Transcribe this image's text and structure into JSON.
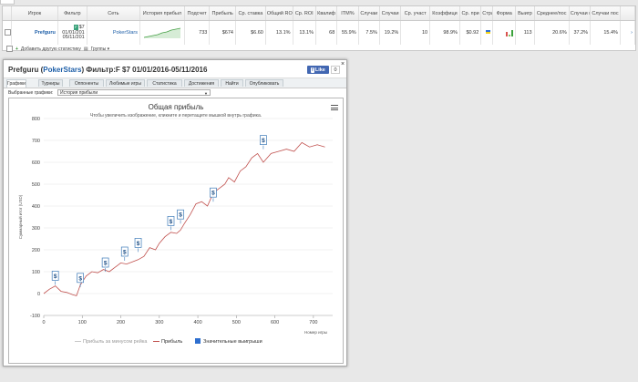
{
  "table": {
    "headers": [
      "",
      "Игрок",
      "Фильтр",
      "Сеть",
      "История прибыл",
      "Подсчет",
      "Прибыль",
      "Ср. ставка",
      "Общий ROI",
      "Ср. ROI",
      "Квалиф",
      "ITM%",
      "Случаи",
      "Случаи",
      "Ср. участ",
      "Коэффици",
      "Ср. при",
      "Стра",
      "Форма",
      "Выигр",
      "Среднее/пос",
      "Случаи пос",
      "Случаи пос",
      ""
    ],
    "row": {
      "player": "Prefguru",
      "filter_lines": [
        "$7",
        "01/01/201",
        "05/11/201"
      ],
      "site": "PokerStars",
      "count": "733",
      "profit": "$674",
      "avg_stake": "$6.60",
      "total_roi": "13.1%",
      "avg_roi": "13.1%",
      "qualif": "68",
      "itm": "55.9%",
      "cases1": "7.5%",
      "cases2": "19.2%",
      "avg_part": "10",
      "coeff": "98.9%",
      "avg_pr": "$0.92",
      "wins": "113",
      "avg_pos": "20.6%",
      "cases_pos1": "37.2%",
      "cases_pos2": "15.4%",
      "arrow": "›"
    },
    "footer_add": "Добавить другую статистику",
    "footer_groups": "Группы ▾"
  },
  "modal": {
    "title_name": "Prefguru",
    "title_site": "PokerStars",
    "title_rest": " Фильтр:F $7 01/01/2016-05/11/2016",
    "fb_like": "Like",
    "fb_count": "0",
    "close": "×",
    "tabs": [
      "Графики",
      "Турниры",
      "Оппоненты",
      "Любимые игры",
      "Статистика",
      "Достижения",
      "Найти",
      "Опубликовать"
    ],
    "selected_label": "Выбранные графики:",
    "selected_value": "История прибыли"
  },
  "colors": {
    "profit_line": "#c0504d",
    "accent": "#1e5fa8",
    "marker": "#3d7ab8",
    "legend_big_win": "#2e6fcf"
  },
  "chart_data": {
    "type": "line",
    "title": "Общая прибыль",
    "subtitle": "Чтобы увеличить изображение, кликните и перетащите мышкой внутрь графика.",
    "xlabel": "Номер игры",
    "ylabel": "Суммарный итог (USD)",
    "xlim": [
      0,
      750
    ],
    "ylim": [
      -100,
      800
    ],
    "xticks": [
      0,
      100,
      200,
      300,
      400,
      500,
      600,
      700
    ],
    "yticks": [
      -100,
      0,
      100,
      200,
      300,
      400,
      500,
      600,
      700,
      800
    ],
    "grid": true,
    "legend_position": "bottom",
    "series": [
      {
        "name": "Прибыль за минусом рейка",
        "color": "#c8c8c8",
        "x": [],
        "y": []
      },
      {
        "name": "Прибыль",
        "color": "#c0504d",
        "x": [
          0,
          15,
          30,
          45,
          60,
          75,
          85,
          95,
          110,
          125,
          140,
          155,
          170,
          185,
          200,
          215,
          230,
          245,
          260,
          275,
          290,
          300,
          315,
          330,
          345,
          355,
          365,
          380,
          395,
          410,
          425,
          440,
          455,
          470,
          480,
          495,
          510,
          525,
          540,
          555,
          570,
          590,
          610,
          630,
          650,
          670,
          690,
          710,
          730
        ],
        "y": [
          0,
          20,
          35,
          10,
          5,
          -5,
          -10,
          40,
          80,
          100,
          95,
          110,
          100,
          120,
          140,
          135,
          145,
          155,
          170,
          210,
          200,
          230,
          260,
          280,
          275,
          290,
          320,
          360,
          410,
          420,
          400,
          460,
          480,
          500,
          530,
          510,
          560,
          580,
          620,
          640,
          600,
          640,
          650,
          660,
          650,
          690,
          670,
          680,
          670
        ]
      },
      {
        "name": "Значительные выигрыши",
        "color": "#2e6fcf",
        "x": [
          30,
          95,
          160,
          210,
          245,
          330,
          355,
          440,
          570
        ],
        "y": [
          40,
          30,
          100,
          150,
          190,
          290,
          320,
          420,
          660
        ]
      }
    ]
  }
}
